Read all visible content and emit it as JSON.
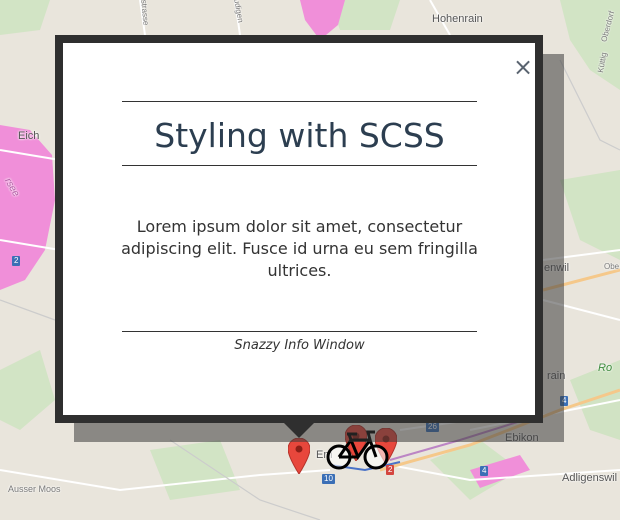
{
  "map": {
    "labels": {
      "hohenrain": "Hohenrain",
      "eich": "Eich",
      "ebikon": "Ebikon",
      "adligenswil": "Adligenswil",
      "ausser_moos": "Ausser Moos",
      "emmen": "Em",
      "rain": "rain",
      "enwil": "enwil",
      "lake": "rsee",
      "green": "Ro",
      "ludigen": "Ludigen",
      "strasse": "strasse",
      "kuttig": "Küttig",
      "oberdorf": "Oberdorf",
      "obe": "Obe"
    },
    "shields": {
      "s2a": "2",
      "s2b": "2",
      "s4a": "4",
      "s4b": "4",
      "s10": "10",
      "s26": "26"
    }
  },
  "info_window": {
    "title": "Styling with SCSS",
    "body": "Lorem ipsum dolor sit amet, consectetur adipiscing elit. Fusce id urna eu sem fringilla ultrices.",
    "footer": "Snazzy Info Window",
    "close_glyph": "×"
  },
  "colors": {
    "map_background": "#e9e5dc",
    "lake": "#f08fd9",
    "frame": "#2f2f2f",
    "title": "#2c3e50",
    "marker": "#e8473c"
  },
  "icons": {
    "marker": "map-marker-icon",
    "bicycle": "bicycle-icon",
    "close": "close-icon"
  }
}
